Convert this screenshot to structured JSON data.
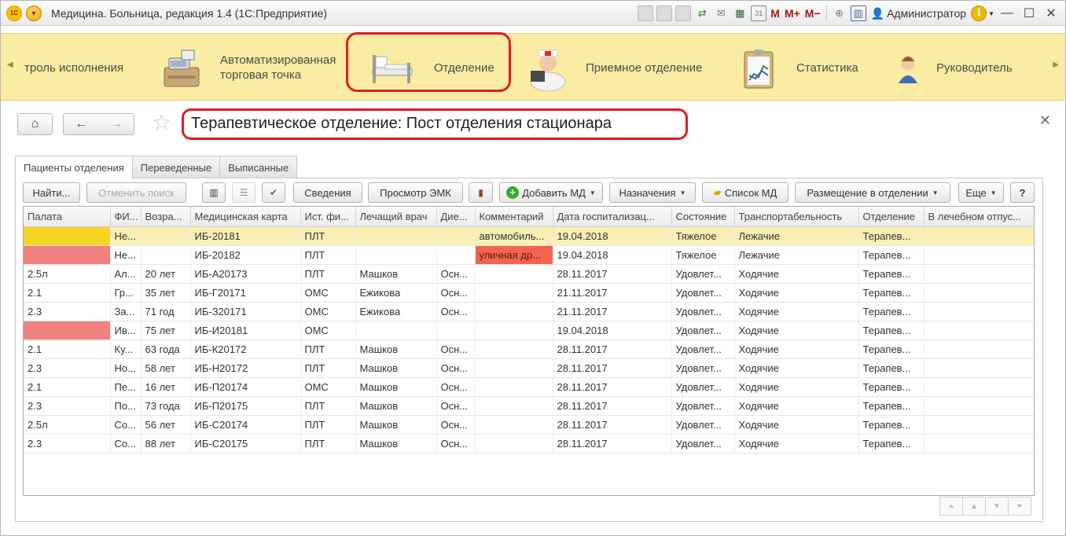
{
  "window": {
    "title": "Медицина. Больница, редакция 1.4 (1С:Предприятие)",
    "user": "Администратор",
    "m_buttons": [
      "M",
      "M+",
      "M−"
    ]
  },
  "sections": {
    "items": [
      {
        "label": "троль исполнения"
      },
      {
        "label_line1": "Автоматизированная",
        "label_line2": "торговая точка"
      },
      {
        "label": "Отделение"
      },
      {
        "label": "Приемное отделение"
      },
      {
        "label": "Статистика"
      },
      {
        "label": "Руководитель"
      }
    ]
  },
  "form": {
    "title": "Терапевтическое отделение: Пост отделения стационара"
  },
  "tabs": [
    {
      "label": "Пациенты отделения"
    },
    {
      "label": "Переведенные"
    },
    {
      "label": "Выписанные"
    }
  ],
  "toolbar": {
    "find": "Найти...",
    "cancel_search": "Отменить поиск",
    "details": "Сведения",
    "view_emk": "Просмотр ЭМК",
    "add_md": "Добавить МД",
    "appointments": "Назначения",
    "md_list": "Список МД",
    "placement": "Размещение в отделении",
    "more": "Еще",
    "help": "?"
  },
  "table": {
    "columns": [
      "Палата",
      "ФИ...",
      "Возра...",
      "Медицинская карта",
      "Ист. фи...",
      "Лечащий врач",
      "Дие...",
      "Комментарий",
      "Дата госпитализац...",
      "Состояние",
      "Транспортабельность",
      "Отделение",
      "В лечебном отпус..."
    ],
    "rows": [
      [
        "",
        "Не...",
        "",
        "ИБ-20181",
        "ПЛТ",
        "",
        "",
        "автомобиль...",
        "19.04.2018",
        "Тяжелое",
        "Лежачие",
        "Терапев...",
        ""
      ],
      [
        "",
        "Не...",
        "",
        "ИБ-20182",
        "ПЛТ",
        "",
        "",
        "уличная др...",
        "19.04.2018",
        "Тяжелое",
        "Лежачие",
        "Терапев...",
        ""
      ],
      [
        "2.5л",
        "Ал...",
        "20 лет",
        "ИБ-А20173",
        "ПЛТ",
        "Машков",
        "Осн...",
        "",
        "28.11.2017",
        "Удовлет...",
        "Ходячие",
        "Терапев...",
        ""
      ],
      [
        "2.1",
        "Гр...",
        "35 лет",
        "ИБ-Г20171",
        "ОМС",
        "Ежикова",
        "Осн...",
        "",
        "21.11.2017",
        "Удовлет...",
        "Ходячие",
        "Терапев...",
        ""
      ],
      [
        "2.3",
        "За...",
        "71 год",
        "ИБ-З20171",
        "ОМС",
        "Ежикова",
        "Осн...",
        "",
        "21.11.2017",
        "Удовлет...",
        "Ходячие",
        "Терапев...",
        ""
      ],
      [
        "",
        "Ив...",
        "75 лет",
        "ИБ-И20181",
        "ОМС",
        "",
        "",
        "",
        "19.04.2018",
        "Удовлет...",
        "Ходячие",
        "Терапев...",
        ""
      ],
      [
        "2.1",
        "Ку...",
        "63 года",
        "ИБ-К20172",
        "ПЛТ",
        "Машков",
        "Осн...",
        "",
        "28.11.2017",
        "Удовлет...",
        "Ходячие",
        "Терапев...",
        ""
      ],
      [
        "2.3",
        "Но...",
        "58 лет",
        "ИБ-Н20172",
        "ПЛТ",
        "Машков",
        "Осн...",
        "",
        "28.11.2017",
        "Удовлет...",
        "Ходячие",
        "Терапев...",
        ""
      ],
      [
        "2.1",
        "Пе...",
        "16 лет",
        "ИБ-П20174",
        "ОМС",
        "Машков",
        "Осн...",
        "",
        "28.11.2017",
        "Удовлет...",
        "Ходячие",
        "Терапев...",
        ""
      ],
      [
        "2.3",
        "По...",
        "73 года",
        "ИБ-П20175",
        "ПЛТ",
        "Машков",
        "Осн...",
        "",
        "28.11.2017",
        "Удовлет...",
        "Ходячие",
        "Терапев...",
        ""
      ],
      [
        "2.5л",
        "Со...",
        "56 лет",
        "ИБ-С20174",
        "ПЛТ",
        "Машков",
        "Осн...",
        "",
        "28.11.2017",
        "Удовлет...",
        "Ходячие",
        "Терапев...",
        ""
      ],
      [
        "2.3",
        "Со...",
        "88 лет",
        "ИБ-С20175",
        "ПЛТ",
        "Машков",
        "Осн...",
        "",
        "28.11.2017",
        "Удовлет...",
        "Ходячие",
        "Терапев...",
        ""
      ]
    ],
    "selected_row": 0,
    "ward_highlight": [
      "yellow",
      "red",
      "",
      "",
      "",
      "red",
      "",
      "",
      "",
      "",
      "",
      ""
    ],
    "comment_highlight": [
      "",
      "red",
      "",
      "",
      "",
      "",
      "",
      "",
      "",
      "",
      "",
      ""
    ]
  },
  "colors": {
    "sections_bg": "#fbeca3",
    "highlight_frame": "#e21a24",
    "selected_row": "#faf0b4",
    "ward_yellow": "#f7d523",
    "ward_red": "#f07f80",
    "comment_red": "#f2644d"
  }
}
